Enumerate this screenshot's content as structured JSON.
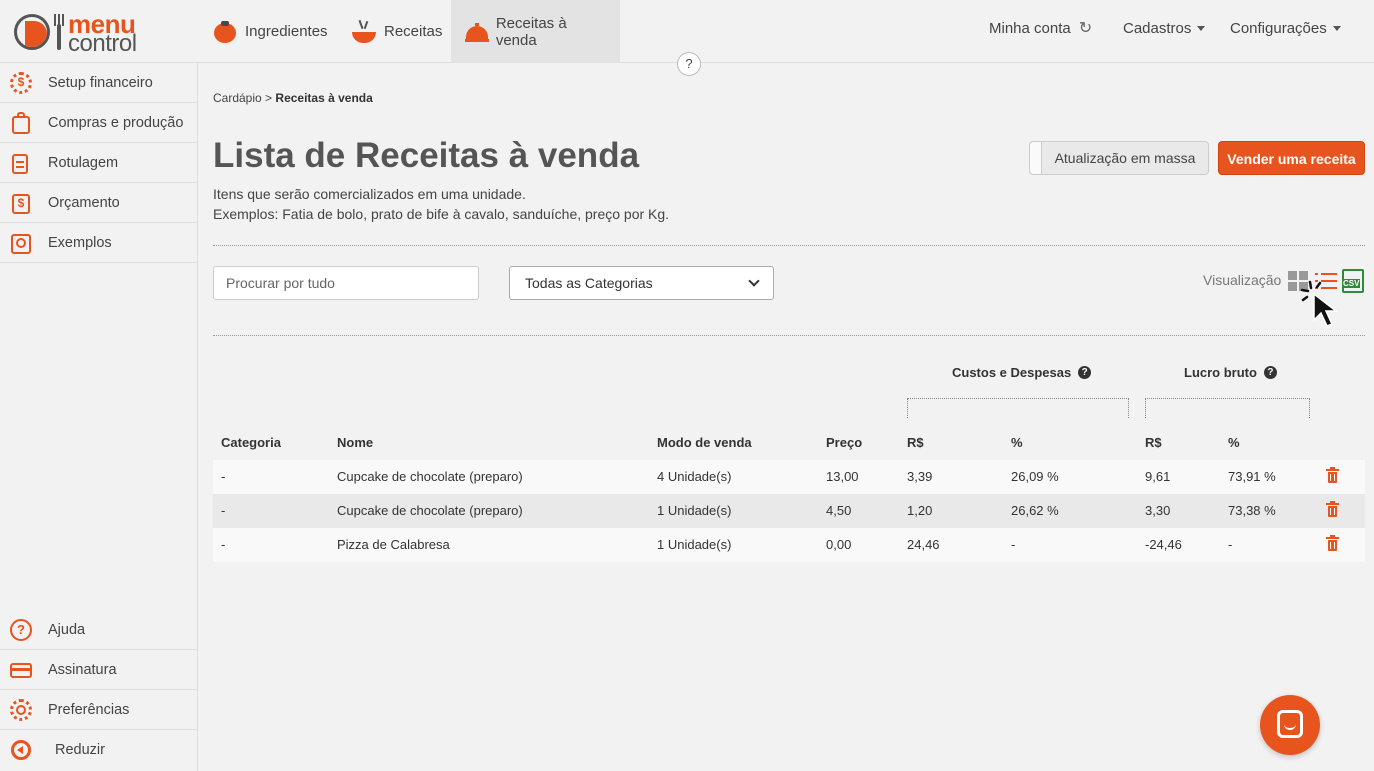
{
  "brand": {
    "line1": "menu",
    "line2": "control"
  },
  "nav": {
    "tabs": [
      {
        "label": "Ingredientes",
        "icon": "tomato-icon"
      },
      {
        "label": "Receitas",
        "icon": "bowl-icon"
      },
      {
        "label": "Receitas à venda",
        "icon": "cloche-icon",
        "active": true
      }
    ],
    "help": "?",
    "account": "Minha conta",
    "cadastros": "Cadastros",
    "configuracoes": "Configurações"
  },
  "sidebar": {
    "items": [
      {
        "label": "Setup financeiro",
        "icon": "dollar-gear-icon"
      },
      {
        "label": "Compras e produção",
        "icon": "shopping-bag-icon"
      },
      {
        "label": "Rotulagem",
        "icon": "label-jar-icon"
      },
      {
        "label": "Orçamento",
        "icon": "budget-icon"
      },
      {
        "label": "Exemplos",
        "icon": "examples-icon"
      }
    ],
    "bottom": [
      {
        "label": "Ajuda",
        "icon": "help-icon"
      },
      {
        "label": "Assinatura",
        "icon": "credit-card-icon"
      },
      {
        "label": "Preferências",
        "icon": "gear-icon"
      },
      {
        "label": "Reduzir",
        "icon": "collapse-icon"
      }
    ]
  },
  "breadcrumb": {
    "parent": "Cardápio",
    "separator": ">",
    "current": "Receitas à venda"
  },
  "page": {
    "title": "Lista de Receitas à venda",
    "subtitle1": "Itens que serão comercializados em uma unidade.",
    "subtitle2": "Exemplos: Fatia de bolo, prato de bife à cavalo, sanduíche, preço por Kg."
  },
  "actions": {
    "mass_update": "Atualização em massa",
    "sell": "Vender uma receita"
  },
  "filters": {
    "search_placeholder": "Procurar por tudo",
    "category_selected": "Todas as Categorias",
    "view_label": "Visualização",
    "csv": "CSV"
  },
  "table": {
    "group_costs": "Custos e Despesas",
    "group_profit": "Lucro bruto",
    "headers": {
      "category": "Categoria",
      "name": "Nome",
      "mode": "Modo de venda",
      "price": "Preço",
      "cost_rs": "R$",
      "cost_pct": "%",
      "profit_rs": "R$",
      "profit_pct": "%"
    },
    "rows": [
      {
        "category": "-",
        "name": "Cupcake de chocolate (preparo)",
        "mode": "4 Unidade(s)",
        "price": "13,00",
        "cost_rs": "3,39",
        "cost_pct": "26,09 %",
        "profit_rs": "9,61",
        "profit_pct": "73,91 %"
      },
      {
        "category": "-",
        "name": "Cupcake de chocolate (preparo)",
        "mode": "1 Unidade(s)",
        "price": "4,50",
        "cost_rs": "1,20",
        "cost_pct": "26,62 %",
        "profit_rs": "3,30",
        "profit_pct": "73,38 %"
      },
      {
        "category": "-",
        "name": "Pizza de Calabresa",
        "mode": "1 Unidade(s)",
        "price": "0,00",
        "cost_rs": "24,46",
        "cost_pct": "-",
        "profit_rs": "-24,46",
        "profit_pct": "-"
      }
    ]
  },
  "colors": {
    "accent": "#e8541e",
    "csv_green": "#2e8b3a",
    "background": "#f2f2f2"
  }
}
